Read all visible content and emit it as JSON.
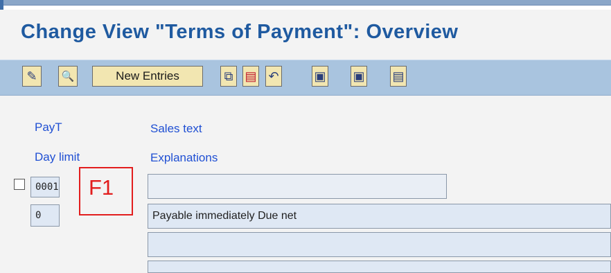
{
  "page": {
    "title": "Change View \"Terms of Payment\": Overview"
  },
  "toolbar": {
    "buttons": [
      {
        "icon": "display-change-icon",
        "glyph": "✎"
      },
      {
        "icon": "magnify-icon",
        "glyph": "🔍"
      },
      {
        "label": "New Entries"
      },
      {
        "icon": "copy-icon",
        "glyph": "⧉"
      },
      {
        "icon": "delete-icon",
        "glyph": "▤"
      },
      {
        "icon": "undo-icon",
        "glyph": "↶"
      },
      {
        "icon": "select-all-icon",
        "glyph": "▣"
      },
      {
        "icon": "select-block-icon",
        "glyph": "▣"
      },
      {
        "icon": "deselect-all-icon",
        "glyph": "▤"
      }
    ]
  },
  "columns": {
    "payt": "PayT",
    "sales_text": "Sales text",
    "day_limit": "Day limit",
    "explanations": "Explanations"
  },
  "row": {
    "payt_value": "0001",
    "sales_text_value": "",
    "day_limit_value": "0",
    "explanation_1": "Payable immediately Due net",
    "explanation_2": "",
    "explanation_3": ""
  },
  "callout": {
    "label": "F1",
    "color": "#e21d1d"
  }
}
